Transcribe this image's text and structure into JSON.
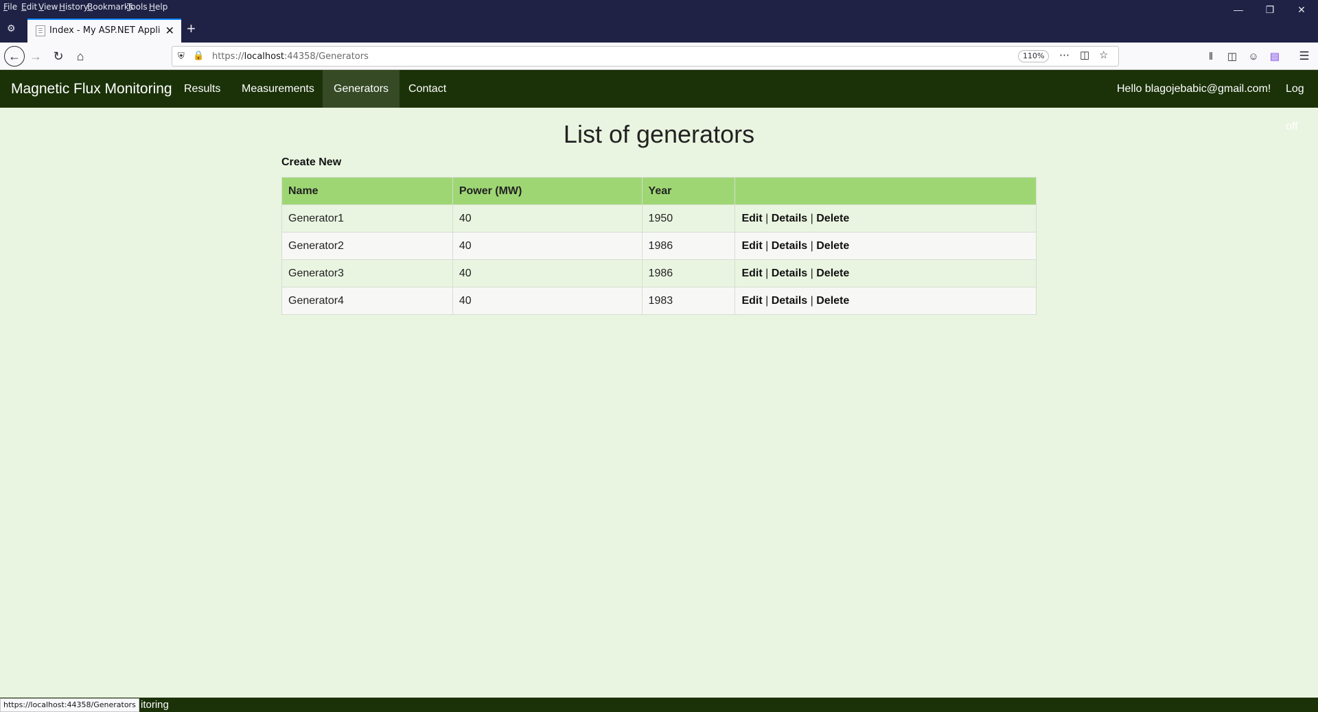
{
  "browser": {
    "menu": [
      "File",
      "Edit",
      "View",
      "History",
      "Bookmarks",
      "Tools",
      "Help"
    ],
    "tab_title": "Index - My ASP.NET Application",
    "url_scheme": "https://",
    "url_host": "localhost",
    "url_rest": ":44358/Generators",
    "zoom": "110%",
    "status_url": "https://localhost:44358/Generators"
  },
  "site": {
    "brand": "Magnetic Flux Monitoring",
    "nav": [
      {
        "label": "Results"
      },
      {
        "label": "Measurements"
      },
      {
        "label": "Generators",
        "active": true
      },
      {
        "label": "Contact"
      }
    ],
    "greeting": "Hello blagojebabic@gmail.com!",
    "logoff": "Log off"
  },
  "main": {
    "title": "List of generators",
    "create_new": "Create New",
    "columns": [
      "Name",
      "Power (MW)",
      "Year",
      ""
    ],
    "rows": [
      {
        "name": "Generator1",
        "power": "40",
        "year": "1950"
      },
      {
        "name": "Generator2",
        "power": "40",
        "year": "1986"
      },
      {
        "name": "Generator3",
        "power": "40",
        "year": "1986"
      },
      {
        "name": "Generator4",
        "power": "40",
        "year": "1983"
      }
    ],
    "actions": {
      "edit": "Edit",
      "details": "Details",
      "delete": "Delete",
      "separator": "|"
    }
  },
  "footer": {
    "text": "itoring"
  },
  "colors": {
    "site_nav": "#1b3209",
    "table_header": "#9ed674",
    "page_bg": "#eaf5e1",
    "browser_chrome": "#1f2245"
  }
}
